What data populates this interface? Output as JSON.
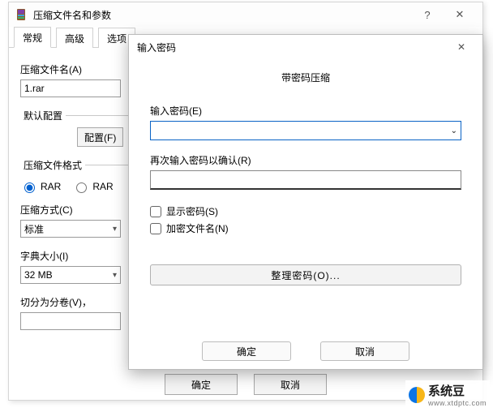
{
  "parent": {
    "title": "压缩文件名和参数",
    "help_btn": "?",
    "close_btn": "✕",
    "tabs": [
      "常规",
      "高级",
      "选项"
    ],
    "filename_label": "压缩文件名(A)",
    "filename_value": "1.rar",
    "profile_label": "默认配置",
    "profile_btn": "配置(F)",
    "format_label": "压缩文件格式",
    "format_rar": "RAR",
    "format_rar5": "RAR",
    "method_label": "压缩方式(C)",
    "method_value": "标准",
    "dict_label": "字典大小(I)",
    "dict_value": "32 MB",
    "split_label": "切分为分卷(V)，",
    "ok": "确定",
    "cancel": "取消"
  },
  "modal": {
    "title": "输入密码",
    "close": "✕",
    "subtitle": "带密码压缩",
    "pw_label": "输入密码(E)",
    "pw2_label": "再次输入密码以确认(R)",
    "show_pw": "显示密码(S)",
    "encrypt_names": "加密文件名(N)",
    "organize": "整理密码(O)...",
    "ok": "确定",
    "cancel": "取消"
  },
  "watermark": {
    "name": "系统豆",
    "url": "www.xtdptc.com"
  }
}
